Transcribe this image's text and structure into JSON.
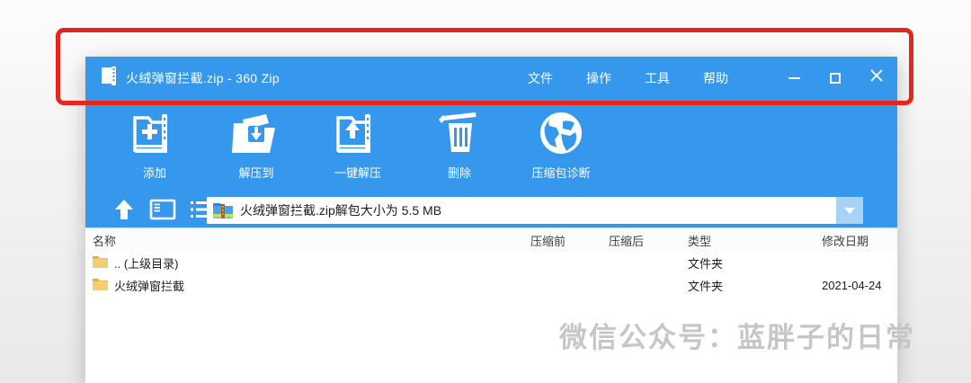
{
  "titlebar": {
    "title": "火绒弹窗拦截.zip - 360 Zip",
    "app_icon": "zip-document-icon",
    "menus": [
      {
        "label": "文件"
      },
      {
        "label": "操作"
      },
      {
        "label": "工具"
      },
      {
        "label": "帮助"
      }
    ],
    "controls": {
      "minimize": "minimize-icon",
      "maximize": "maximize-icon",
      "close": "close-icon"
    }
  },
  "toolbar": {
    "buttons": [
      {
        "label": "添加",
        "icon": "add-archive-icon"
      },
      {
        "label": "解压到",
        "icon": "extract-to-icon"
      },
      {
        "label": "一键解压",
        "icon": "one-click-extract-icon"
      },
      {
        "label": "删除",
        "icon": "delete-trash-icon"
      },
      {
        "label": "压缩包诊断",
        "icon": "archive-diagnose-globe-icon"
      }
    ]
  },
  "navbar": {
    "icons": [
      "up-arrow-icon",
      "panel-view-icon",
      "list-view-icon"
    ],
    "address_value": "火绒弹窗拦截.zip解包大小为 5.5 MB",
    "address_icon": "zip-folder-icon",
    "dropdown": "chevron-down-icon"
  },
  "filelist": {
    "columns": [
      "名称",
      "压缩前",
      "压缩后",
      "类型",
      "修改日期"
    ],
    "rows": [
      {
        "name": ".. (上级目录)",
        "size_before": "",
        "size_after": "",
        "type": "文件夹",
        "date_modified": ""
      },
      {
        "name": "火绒弹窗拦截",
        "size_before": "",
        "size_after": "",
        "type": "文件夹",
        "date_modified": "2021-04-24"
      }
    ]
  },
  "watermark": {
    "text": "微信公众号：蓝胖子的日常"
  },
  "colors": {
    "titlebar_blue": "#3598ec",
    "dropdown_light_blue": "#a9d3f6",
    "annotation_red": "#e4261d",
    "folder_yellow": "#f2cd72",
    "watermark_gray": "#c6c6c6"
  }
}
